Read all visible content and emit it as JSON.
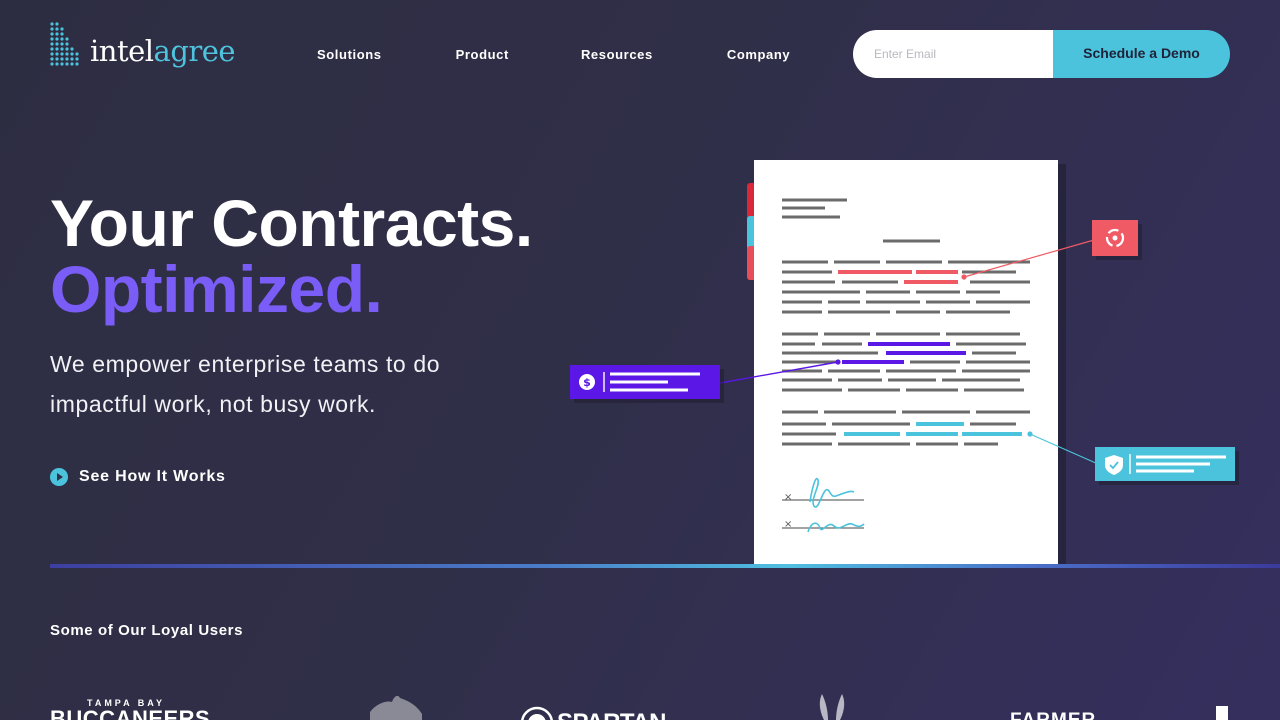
{
  "brand": {
    "name_part1": "intel",
    "name_part2": "agree",
    "primary_color": "#4cc3dc",
    "accent_color": "#7a5cf6",
    "icon": "dot-grid-logo-icon"
  },
  "nav": {
    "items": [
      "Solutions",
      "Product",
      "Resources",
      "Company"
    ]
  },
  "cta": {
    "email_placeholder": "Enter Email",
    "button_label": "Schedule a Demo"
  },
  "hero": {
    "title_line1": "Your Contracts.",
    "title_line2": "Optimized.",
    "subtitle": "We empower enterprise teams to do impactful work, not busy work.",
    "link_label": "See How It Works",
    "link_icon": "play-circle-icon"
  },
  "illustration": {
    "callout_icons": [
      "dollar-icon",
      "refresh-icon",
      "shield-check-icon"
    ],
    "callout_colors": [
      "#5a17e6",
      "#f05a64",
      "#4cc3dc"
    ]
  },
  "clients": {
    "title": "Some of Our Loyal Users",
    "logos": [
      {
        "name": "tampa-bay-buccaneers-logo",
        "text_top": "TAMPA BAY",
        "text_main": "BUCCANEERS"
      },
      {
        "name": "bull-logo",
        "text_main": ""
      },
      {
        "name": "spartan-logo",
        "text_main": "SPARTAN"
      },
      {
        "name": "wings-logo",
        "text_main": ""
      },
      {
        "name": "farmer-logo",
        "text_main": "FARMER"
      }
    ]
  }
}
